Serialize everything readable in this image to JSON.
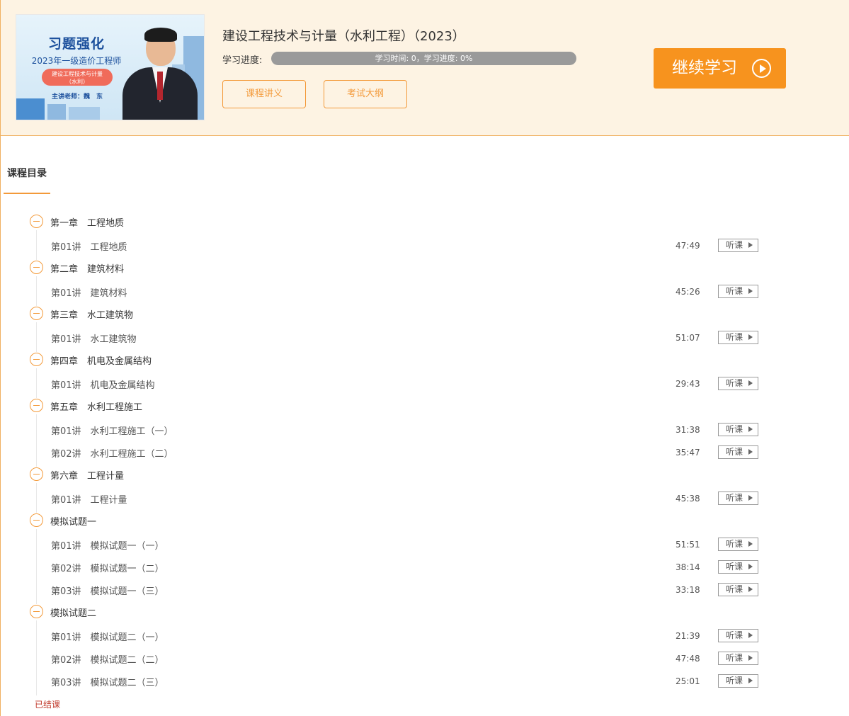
{
  "course": {
    "title": "建设工程技术与计量（水利工程）（2023）",
    "progress_label": "学习进度:",
    "progress_percent": 0,
    "progress_text": "学习时间: 0，学习进度: 0%",
    "lecture_notes_button": "课程讲义",
    "syllabus_button": "考试大纲",
    "continue_button": "继续学习",
    "thumbnail": {
      "title": "习题强化",
      "subtitle": "2023年一级造价工程师",
      "pill_line1": "建设工程技术与计量",
      "pill_line2": "（水利）",
      "teacher": "主讲老师：魏　东"
    }
  },
  "catalog": {
    "title": "课程目录",
    "chapters": [
      {
        "title": "第一章　工程地质",
        "lessons": [
          {
            "title": "第01讲　工程地质",
            "duration": "47:49",
            "button": "听课"
          }
        ]
      },
      {
        "title": "第二章　建筑材料",
        "lessons": [
          {
            "title": "第01讲　建筑材料",
            "duration": "45:26",
            "button": "听课"
          }
        ]
      },
      {
        "title": "第三章　水工建筑物",
        "lessons": [
          {
            "title": "第01讲　水工建筑物",
            "duration": "51:07",
            "button": "听课"
          }
        ]
      },
      {
        "title": "第四章　机电及金属结构",
        "lessons": [
          {
            "title": "第01讲　机电及金属结构",
            "duration": "29:43",
            "button": "听课"
          }
        ]
      },
      {
        "title": "第五章　水利工程施工",
        "lessons": [
          {
            "title": "第01讲　水利工程施工（一）",
            "duration": "31:38",
            "button": "听课"
          },
          {
            "title": "第02讲　水利工程施工（二）",
            "duration": "35:47",
            "button": "听课"
          }
        ]
      },
      {
        "title": "第六章　工程计量",
        "lessons": [
          {
            "title": "第01讲　工程计量",
            "duration": "45:38",
            "button": "听课"
          }
        ]
      },
      {
        "title": "模拟试题一",
        "lessons": [
          {
            "title": "第01讲　模拟试题一（一）",
            "duration": "51:51",
            "button": "听课"
          },
          {
            "title": "第02讲　模拟试题一（二）",
            "duration": "38:14",
            "button": "听课"
          },
          {
            "title": "第03讲　模拟试题一（三）",
            "duration": "33:18",
            "button": "听课"
          }
        ]
      },
      {
        "title": "模拟试题二",
        "lessons": [
          {
            "title": "第01讲　模拟试题二（一）",
            "duration": "21:39",
            "button": "听课"
          },
          {
            "title": "第02讲　模拟试题二（二）",
            "duration": "47:48",
            "button": "听课"
          },
          {
            "title": "第03讲　模拟试题二（三）",
            "duration": "25:01",
            "button": "听课"
          }
        ]
      }
    ],
    "status": "已结课"
  },
  "colors": {
    "accent": "#f7931e",
    "header_bg": "#fdf3e3",
    "ended_text": "#c0392b"
  }
}
